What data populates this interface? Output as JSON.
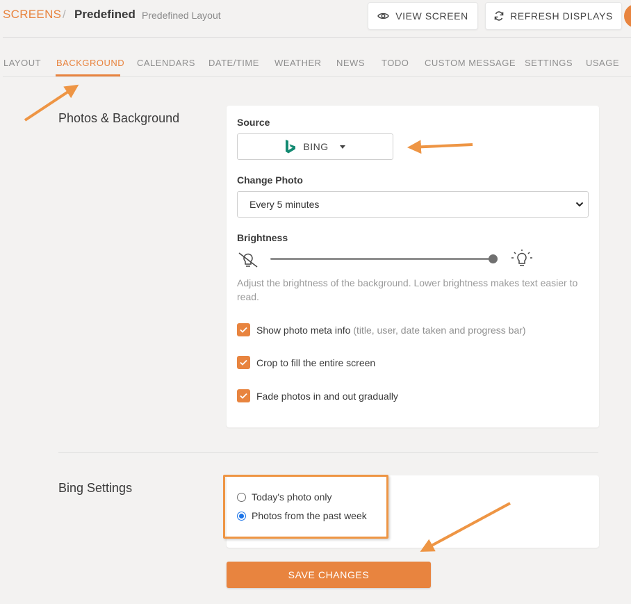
{
  "breadcrumb": {
    "root": "SCREENS",
    "separator": "/",
    "current": "Predefined",
    "subtitle": "Predefined Layout"
  },
  "header_buttons": {
    "view_screen": "VIEW SCREEN",
    "refresh_displays": "REFRESH DISPLAYS"
  },
  "tabs": [
    {
      "label": "LAYOUT",
      "active": false
    },
    {
      "label": "BACKGROUND",
      "active": true
    },
    {
      "label": "CALENDARS",
      "active": false
    },
    {
      "label": "DATE/TIME",
      "active": false
    },
    {
      "label": "WEATHER",
      "active": false
    },
    {
      "label": "NEWS",
      "active": false
    },
    {
      "label": "TODO",
      "active": false
    },
    {
      "label": "CUSTOM MESSAGE",
      "active": false
    },
    {
      "label": "SETTINGS",
      "active": false
    },
    {
      "label": "USAGE",
      "active": false
    }
  ],
  "photos_section": {
    "title": "Photos & Background",
    "source_label": "Source",
    "source_value": "BING",
    "source_icon": "bing-logo-icon",
    "change_photo_label": "Change Photo",
    "change_photo_value": "Every 5 minutes",
    "brightness_label": "Brightness",
    "brightness_level": 1.0,
    "brightness_help": "Adjust the brightness of the background. Lower brightness makes text easier to read.",
    "options": [
      {
        "label": "Show photo meta info",
        "hint": "(title, user, date taken and progress bar)",
        "checked": true
      },
      {
        "label": "Crop to fill the entire screen",
        "hint": "",
        "checked": true
      },
      {
        "label": "Fade photos in and out gradually",
        "hint": "",
        "checked": true
      }
    ]
  },
  "bing_section": {
    "title": "Bing Settings",
    "radios": [
      {
        "label": "Today's photo only",
        "checked": false
      },
      {
        "label": "Photos from the past week",
        "checked": true
      }
    ]
  },
  "save_button": "SAVE CHANGES",
  "colors": {
    "accent": "#e8843f",
    "background": "#f3f2f1",
    "card": "#ffffff",
    "radio_selected": "#1a73e8",
    "bing_green": "#138a72"
  }
}
